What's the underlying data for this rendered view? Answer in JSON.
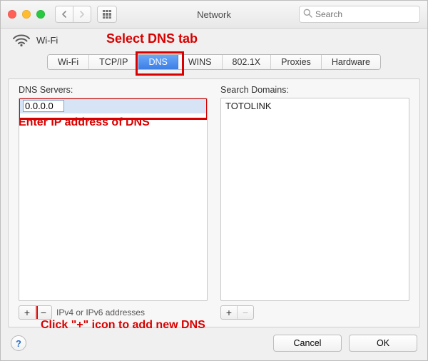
{
  "window": {
    "title": "Network"
  },
  "toolbar": {
    "search_placeholder": "Search"
  },
  "subheader": {
    "wifi_label": "Wi-Fi"
  },
  "annotations": {
    "top": "Select DNS tab",
    "mid": "Enter IP address of DNS",
    "bottom": "Click \"+\" icon to add new DNS"
  },
  "tabs": [
    "Wi-Fi",
    "TCP/IP",
    "DNS",
    "WINS",
    "802.1X",
    "Proxies",
    "Hardware"
  ],
  "selected_tab_index": 2,
  "dns_panel": {
    "servers_label": "DNS Servers:",
    "domains_label": "Search Domains:",
    "servers": [
      "0.0.0.0"
    ],
    "servers_editing_index": 0,
    "domains": [
      "TOTOLINK"
    ],
    "servers_hint": "IPv4 or IPv6 addresses"
  },
  "buttons": {
    "cancel": "Cancel",
    "ok": "OK",
    "help": "?"
  }
}
